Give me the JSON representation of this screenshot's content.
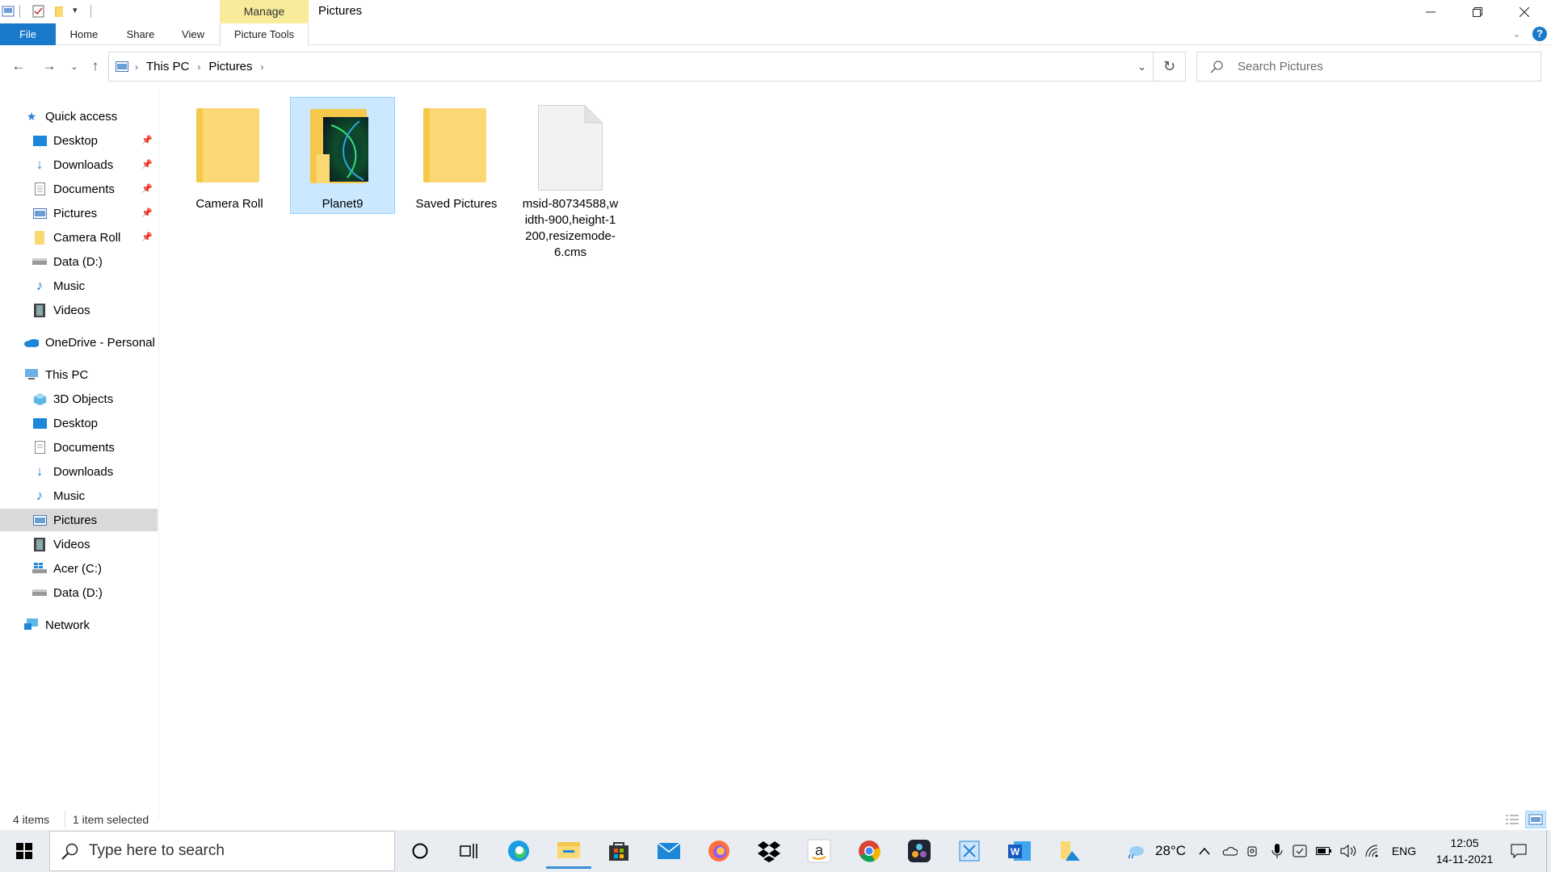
{
  "window": {
    "title": "Pictures",
    "manage_tab": "Manage",
    "minimize_icon": "minimize-icon",
    "maximize_icon": "restore-icon",
    "close_icon": "close-icon"
  },
  "ribbon": {
    "tabs": [
      {
        "label": "File"
      },
      {
        "label": "Home"
      },
      {
        "label": "Share"
      },
      {
        "label": "View"
      },
      {
        "label": "Picture Tools"
      }
    ]
  },
  "address": {
    "crumbs": [
      "This PC",
      "Pictures"
    ],
    "search_placeholder": "Search Pictures"
  },
  "sidebar": {
    "items": [
      {
        "label": "Quick access",
        "icon": "star-icon"
      },
      {
        "label": "Desktop",
        "icon": "desktop-icon",
        "pinned": true
      },
      {
        "label": "Downloads",
        "icon": "download-icon",
        "pinned": true
      },
      {
        "label": "Documents",
        "icon": "document-icon",
        "pinned": true
      },
      {
        "label": "Pictures",
        "icon": "pictures-icon",
        "pinned": true
      },
      {
        "label": "Camera Roll",
        "icon": "folder-icon",
        "pinned": true
      },
      {
        "label": "Data (D:)",
        "icon": "drive-icon"
      },
      {
        "label": "Music",
        "icon": "music-icon"
      },
      {
        "label": "Videos",
        "icon": "video-icon"
      },
      {
        "label": "OneDrive - Personal",
        "icon": "cloud-icon"
      },
      {
        "label": "This PC",
        "icon": "computer-icon"
      },
      {
        "label": "3D Objects",
        "icon": "cube-icon"
      },
      {
        "label": "Desktop",
        "icon": "desktop-icon"
      },
      {
        "label": "Documents",
        "icon": "document-icon"
      },
      {
        "label": "Downloads",
        "icon": "download-icon"
      },
      {
        "label": "Music",
        "icon": "music-icon"
      },
      {
        "label": "Pictures",
        "icon": "pictures-icon",
        "selected": true
      },
      {
        "label": "Videos",
        "icon": "video-icon"
      },
      {
        "label": "Acer (C:)",
        "icon": "windows-drive-icon"
      },
      {
        "label": "Data (D:)",
        "icon": "drive-icon"
      },
      {
        "label": "Network",
        "icon": "network-icon"
      }
    ]
  },
  "files": [
    {
      "name": "Camera Roll",
      "type": "folder"
    },
    {
      "name": "Planet9",
      "type": "folder",
      "selected": true
    },
    {
      "name": "Saved Pictures",
      "type": "folder"
    },
    {
      "name": "msid-80734588,width-900,height-1200,resizemode-6.cms",
      "name_lines": [
        "msid-80734588,w",
        "idth-900,height-1",
        "200,resizemode-",
        "6.cms"
      ],
      "type": "file"
    }
  ],
  "status": {
    "item_count": "4 items",
    "selection": "1 item selected"
  },
  "taskbar": {
    "search_placeholder": "Type here to search",
    "weather": "28°C",
    "language": "ENG",
    "time": "12:05",
    "date": "14-11-2021",
    "apps": [
      "cortana-icon",
      "task-view-icon",
      "edge-icon",
      "file-explorer-icon",
      "store-icon",
      "mail-icon",
      "firefox-icon",
      "dropbox-icon",
      "amazon-icon",
      "chrome-icon",
      "davinci-icon",
      "snipping-icon",
      "word-icon",
      "photos-icon"
    ]
  },
  "colors": {
    "file_tab": "#1979ca",
    "manage_tab": "#f8ec9b",
    "selection": "#cce8ff",
    "folder": "#fad974"
  }
}
